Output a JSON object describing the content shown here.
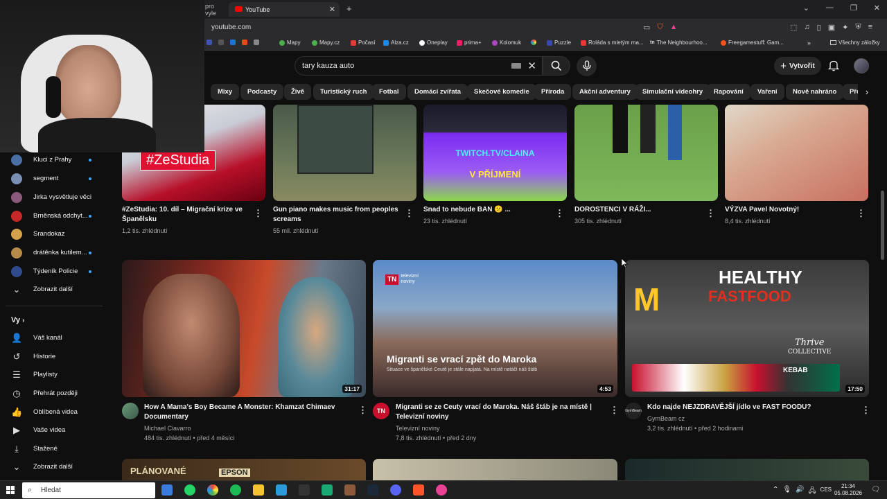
{
  "browser": {
    "tabs": [
      {
        "label": "pro vyle"
      },
      {
        "label": "YouTube"
      }
    ],
    "url": "youtube.com",
    "bookmarks": [
      {
        "label": "Mapy",
        "color": "#4cae4f"
      },
      {
        "label": "Mapy.cz",
        "color": "#4cae4f"
      },
      {
        "label": "Počasí",
        "color": "#e53935"
      },
      {
        "label": "Alza.cz",
        "color": "#1e88e5"
      },
      {
        "label": "Oneplay",
        "color": "#ffffff"
      },
      {
        "label": "prima+",
        "color": "#e91e63"
      },
      {
        "label": "Kolomuk",
        "color": "#ab47bc"
      },
      {
        "label": "Puzzle",
        "color": "#3949ab"
      },
      {
        "label": "Roláda s mletým ma...",
        "color": "#e53935"
      },
      {
        "label": "The Neighbourhoo...",
        "color": "#ffffff"
      },
      {
        "label": "Freegamestuff: Gam...",
        "color": "#f4511e"
      }
    ],
    "all_bookmarks": "Všechny záložky"
  },
  "youtube": {
    "search_value": "tary kauza auto",
    "create_label": "Vytvořit",
    "chips": [
      "Mixy",
      "Podcasty",
      "Živě",
      "Turistický ruch",
      "Fotbal",
      "Domácí zvířata",
      "Skečové komedie",
      "Příroda",
      "Akční adventury",
      "Simulační videohry",
      "Rapování",
      "Vaření",
      "Nově nahráno",
      "Přeh"
    ]
  },
  "sidebar": {
    "subscriptions": [
      {
        "label": "Kluci z Prahy",
        "color": "#4a6fa5"
      },
      {
        "label": "segment",
        "color": "#7b8fb5"
      },
      {
        "label": "Jirka vysvětluje věci",
        "color": "#8b5a7a"
      },
      {
        "label": "Brněnská odchyt...",
        "color": "#c62828"
      },
      {
        "label": "Srandokaz",
        "color": "#d4a24c"
      },
      {
        "label": "drátěnka kutilem...",
        "color": "#b88a4a"
      },
      {
        "label": "Týdeník Policie",
        "color": "#2e4a8a"
      }
    ],
    "show_more_subs": "Zobrazit další",
    "you_header": "Vy",
    "you_items": [
      {
        "label": "Váš kanál",
        "icon": "user-icon"
      },
      {
        "label": "Historie",
        "icon": "history-icon"
      },
      {
        "label": "Playlisty",
        "icon": "playlist-icon"
      },
      {
        "label": "Přehrát později",
        "icon": "clock-icon"
      },
      {
        "label": "Oblíbená videa",
        "icon": "thumbs-up-icon"
      },
      {
        "label": "Vaše videa",
        "icon": "video-icon"
      },
      {
        "label": "Stažené",
        "icon": "download-icon"
      },
      {
        "label": "Zobrazit další",
        "icon": "chevron-down-icon"
      }
    ]
  },
  "row1": [
    {
      "title": "#ZeStudia: 10. díl – Migrační krize ve Španělsku",
      "meta": "1,2 tis. zhlédnutí",
      "thumb_text": "ZeStudia"
    },
    {
      "title": "Gun piano makes music from peoples screams",
      "meta": "55 mil. zhlédnutí"
    },
    {
      "title": "Snad to nebude BAN 😕 ...",
      "meta": "23 tis. zhlédnutí",
      "thumb_text1": "TWITCH.TV/CLAINA",
      "thumb_text2": "V PŘÍJMENÍ"
    },
    {
      "title": "DOROSTENCI V RÁŽI...",
      "meta": "305 tis. zhlédnutí"
    },
    {
      "title": "VÝZVA Pavel Novotný!",
      "meta": "8,4 tis. zhlédnutí"
    }
  ],
  "row2": [
    {
      "title": "How A Mama's Boy Became A Monster: Khamzat Chimaev Documentary",
      "channel": "Michael Ciavarro",
      "meta": "484 tis. zhlédnutí • před 4 měsíci",
      "duration": "31:17"
    },
    {
      "title": "Migranti se ze Ceuty vrací do Maroka. Náš štáb je na místě | Televizní noviny",
      "channel": "Televizní noviny",
      "meta": "7,8 tis. zhlédnutí • před 2 dny",
      "duration": "4:53",
      "thumb_logo": "TN",
      "thumb_logo_sub": "televizní noviny",
      "thumb_title": "Migranti se vrací zpět do Maroka",
      "thumb_sub": "Situace ve španělské Ceutě je stále napjatá. Na místě natáčí náš štáb",
      "channel_avatar": "TN"
    },
    {
      "title": "Kdo najde NEJZDRAVĚJŠÍ jídlo ve FAST FOODU?",
      "channel": "GymBeam cz",
      "meta": "3,2 tis. zhlédnutí • před 2 hodinami",
      "duration": "17:50",
      "thumb_t1": "HEALTHY",
      "thumb_t2": "FASTFOOD",
      "thumb_t3": "Thrive",
      "thumb_t4": "COLLECTIVE",
      "thumb_t5": "KEBAB",
      "channel_avatar": "GymBeam"
    }
  ],
  "row3": [
    {
      "thumb_t1": "PLÁNOVANÉ",
      "thumb_t2": "EPSON"
    }
  ],
  "taskbar": {
    "search_placeholder": "Hledat",
    "lang": "CES",
    "time": "21:34",
    "date": "05.08.2026"
  }
}
